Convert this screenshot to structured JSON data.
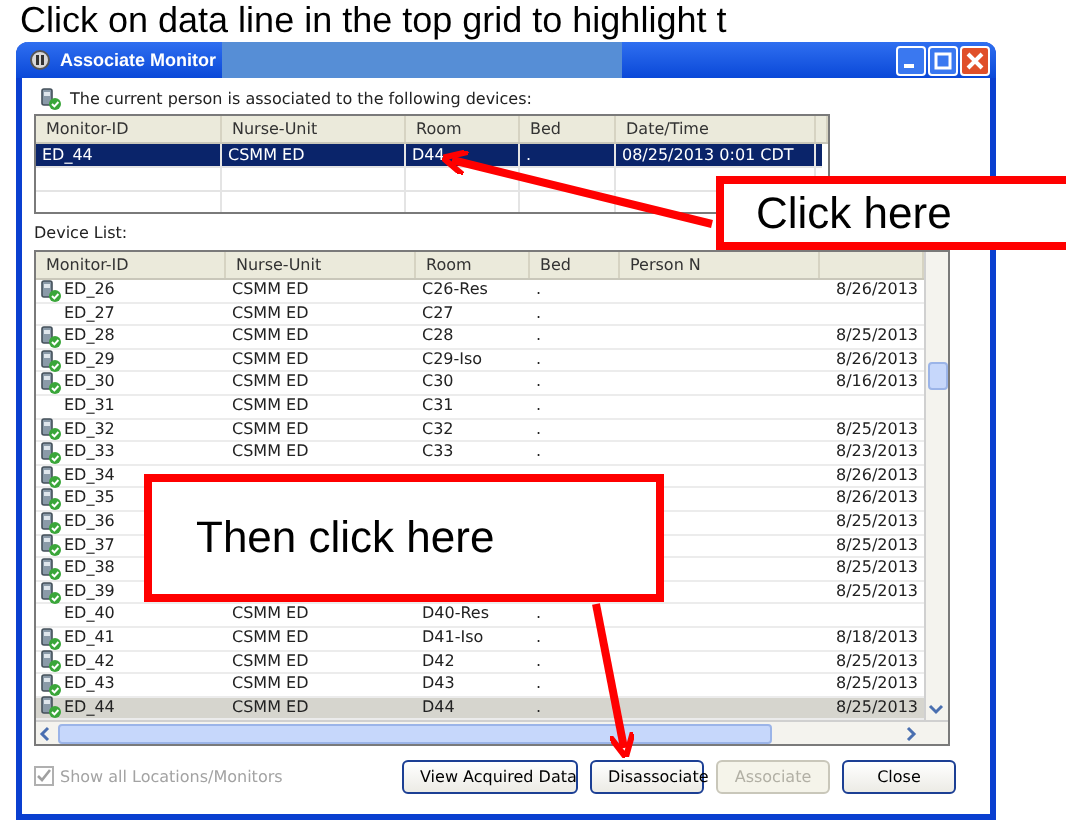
{
  "heading": "Click on data line in the top grid to highlight t",
  "window": {
    "title": "Associate Monitor",
    "redacted": true
  },
  "info_text": "The current person is associated to the following devices:",
  "current_devices": {
    "columns": [
      "Monitor-ID",
      "Nurse-Unit",
      "Room",
      "Bed",
      "Date/Time"
    ],
    "rows": [
      {
        "cells": [
          "ED_44",
          "CSMM ED",
          "D44",
          ".",
          "08/25/2013 0:01 CDT"
        ],
        "selected": true
      }
    ]
  },
  "device_list_label": "Device List:",
  "device_list": {
    "columns": [
      "Monitor-ID",
      "Nurse-Unit",
      "Room",
      "Bed",
      "Person N"
    ],
    "rows": [
      {
        "icon": true,
        "id": "ED_26",
        "unit": "CSMM ED",
        "room": "C26-Res",
        "bed": ".",
        "date": "8/26/2013",
        "selected": false
      },
      {
        "icon": false,
        "id": "ED_27",
        "unit": "CSMM ED",
        "room": "C27",
        "bed": ".",
        "selected": false
      },
      {
        "icon": true,
        "id": "ED_28",
        "unit": "CSMM ED",
        "room": "C28",
        "bed": ".",
        "date": "8/25/2013",
        "selected": false
      },
      {
        "icon": true,
        "id": "ED_29",
        "unit": "CSMM ED",
        "room": "C29-Iso",
        "bed": ".",
        "date": "8/26/2013",
        "selected": false
      },
      {
        "icon": true,
        "id": "ED_30",
        "unit": "CSMM ED",
        "room": "C30",
        "bed": ".",
        "date": "8/16/2013",
        "selected": false
      },
      {
        "icon": false,
        "id": "ED_31",
        "unit": "CSMM ED",
        "room": "C31",
        "bed": ".",
        "selected": false
      },
      {
        "icon": true,
        "id": "ED_32",
        "unit": "CSMM ED",
        "room": "C32",
        "bed": ".",
        "date": "8/25/2013",
        "selected": false
      },
      {
        "icon": true,
        "id": "ED_33",
        "unit": "CSMM ED",
        "room": "C33",
        "bed": ".",
        "date": "8/23/2013",
        "selected": false
      },
      {
        "icon": true,
        "id": "ED_34",
        "date": "8/26/2013",
        "selected": false
      },
      {
        "icon": true,
        "id": "ED_35",
        "date": "8/26/2013",
        "selected": false
      },
      {
        "icon": true,
        "id": "ED_36",
        "date": "8/25/2013",
        "selected": false
      },
      {
        "icon": true,
        "id": "ED_37",
        "date": "8/25/2013",
        "selected": false
      },
      {
        "icon": true,
        "id": "ED_38",
        "date": "8/25/2013",
        "selected": false
      },
      {
        "icon": true,
        "id": "ED_39",
        "date": "8/25/2013",
        "selected": false
      },
      {
        "icon": false,
        "id": "ED_40",
        "unit": "CSMM ED",
        "room": "D40-Res",
        "bed": ".",
        "selected": false
      },
      {
        "icon": true,
        "id": "ED_41",
        "unit": "CSMM ED",
        "room": "D41-Iso",
        "bed": ".",
        "date": "8/18/2013",
        "selected": false
      },
      {
        "icon": true,
        "id": "ED_42",
        "unit": "CSMM ED",
        "room": "D42",
        "bed": ".",
        "date": "8/25/2013",
        "selected": false
      },
      {
        "icon": true,
        "id": "ED_43",
        "unit": "CSMM ED",
        "room": "D43",
        "bed": ".",
        "date": "8/25/2013",
        "selected": false
      },
      {
        "icon": true,
        "id": "ED_44",
        "unit": "CSMM ED",
        "room": "D44",
        "bed": ".",
        "date": "8/25/2013",
        "selected": true
      }
    ]
  },
  "show_all": {
    "label": "Show all Locations/Monitors",
    "checked": true,
    "disabled": true
  },
  "buttons": [
    {
      "label": "View Acquired Data",
      "disabled": false
    },
    {
      "label": "Disassociate",
      "disabled": false
    },
    {
      "label": "Associate",
      "disabled": true
    },
    {
      "label": "Close",
      "disabled": false
    }
  ],
  "callouts": [
    {
      "text": "Click here"
    },
    {
      "text": "Then click here"
    }
  ]
}
